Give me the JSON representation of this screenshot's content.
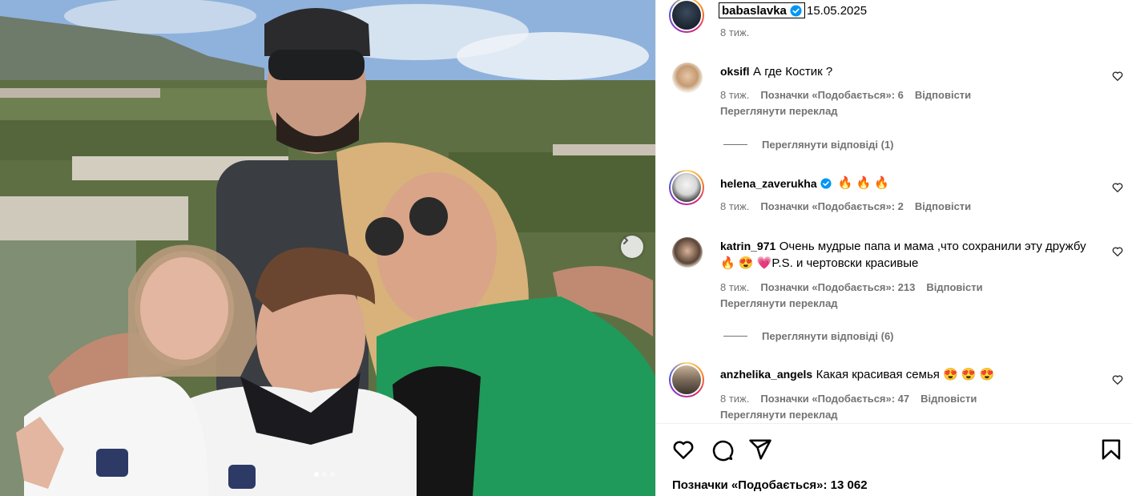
{
  "post": {
    "author": "babaslavka",
    "date": "15.05.2025",
    "age": "8 тиж."
  },
  "comments": [
    {
      "user": "oksifl",
      "text": "А где Костик ?",
      "age": "8 тиж.",
      "likes": "Позначки «Подобається»: 6",
      "reply": "Відповісти",
      "translate": "Переглянути переклад",
      "view_replies": "Переглянути відповіді (1)"
    },
    {
      "user": "helena_zaverukha",
      "text": "🔥 🔥 🔥",
      "age": "8 тиж.",
      "likes": "Позначки «Подобається»: 2",
      "reply": "Відповісти"
    },
    {
      "user": "katrin_971",
      "text": "Очень мудрые папа и мама ,что сохранили эту дружбу 🔥 😍 💗P.S. и чертовски красивые",
      "age": "8 тиж.",
      "likes": "Позначки «Подобається»: 213",
      "reply": "Відповісти",
      "translate": "Переглянути переклад",
      "view_replies": "Переглянути відповіді (6)"
    },
    {
      "user": "anzhelika_angels",
      "text": "Какая красивая семья 😍 😍 😍",
      "age": "8 тиж.",
      "likes": "Позначки «Подобається»: 47",
      "reply": "Відповісти",
      "translate": "Переглянути переклад"
    }
  ],
  "footer": {
    "likes": "Позначки «Подобається»: 13 062"
  },
  "icons": [
    "heart-icon",
    "comment-icon",
    "share-icon",
    "bookmark-icon",
    "verified-icon",
    "chevron-right-icon"
  ],
  "colors": {
    "verified": "#0095f6",
    "secondary_text": "#737373",
    "jacket": "#1f9a5a"
  }
}
